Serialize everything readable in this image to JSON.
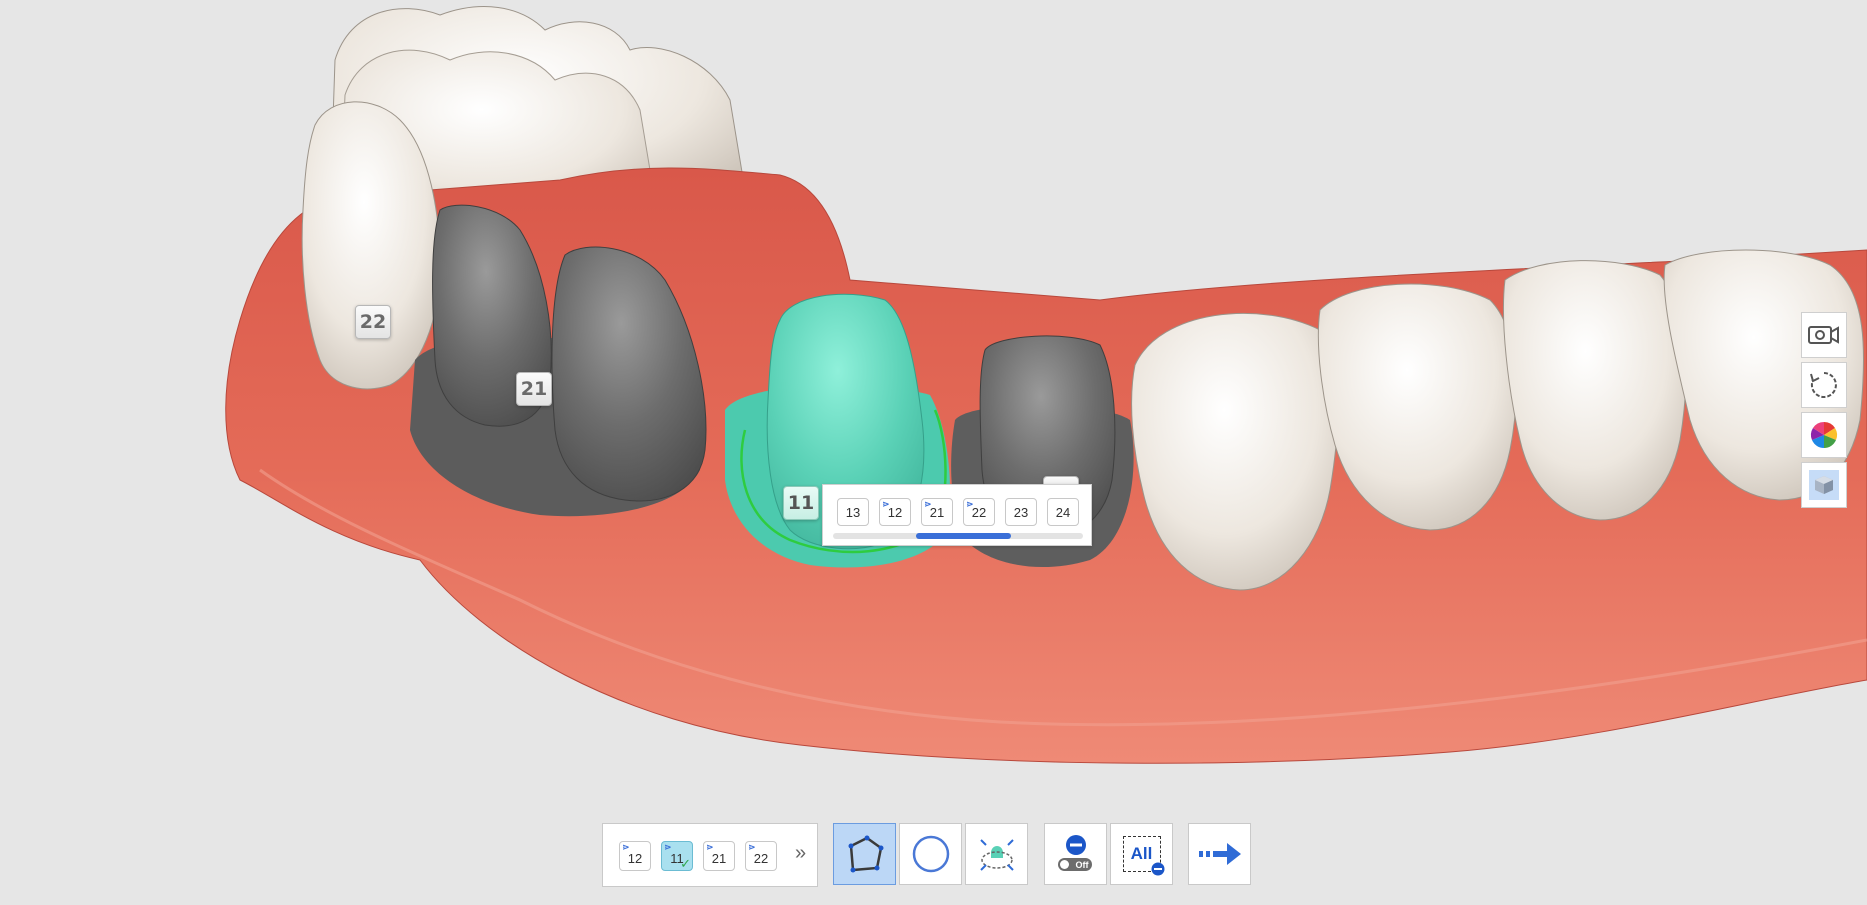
{
  "scene": {
    "colors": {
      "background": "#e6e6e6",
      "gum": "#e06654",
      "tooth": "#eee8e0",
      "prep": "#6b6b6b",
      "selected_prep": "#5ad1b6",
      "margin_line": "#2ecc40"
    },
    "tooth_labels": [
      {
        "id": "22",
        "label": "22"
      },
      {
        "id": "21",
        "label": "21"
      },
      {
        "id": "11",
        "label": "11",
        "active": true
      }
    ]
  },
  "tooth_selector": {
    "teeth": [
      {
        "label": "13",
        "prepared": false
      },
      {
        "label": "12",
        "prepared": true
      },
      {
        "label": "21",
        "prepared": true
      },
      {
        "label": "22",
        "prepared": true
      },
      {
        "label": "23",
        "prepared": false
      },
      {
        "label": "24",
        "prepared": false
      }
    ],
    "scroll": {
      "start": 0.33,
      "length": 0.38
    },
    "accent": "#3a6fd8"
  },
  "side_toolbar": [
    {
      "name": "camera-icon"
    },
    {
      "name": "rotate-icon"
    },
    {
      "name": "color-wheel-icon"
    },
    {
      "name": "cube-icon",
      "active": true
    }
  ],
  "bottom_toolbar": {
    "teeth": [
      {
        "label": "12",
        "active": false,
        "done": false
      },
      {
        "label": "11",
        "active": true,
        "done": true
      },
      {
        "label": "21",
        "active": false,
        "done": false
      },
      {
        "label": "22",
        "active": false,
        "done": false
      }
    ],
    "more_icon": "»",
    "tools": [
      {
        "name": "polygon-margin-icon",
        "active": true
      },
      {
        "name": "circle-icon",
        "active": false
      },
      {
        "name": "auto-margin-icon",
        "active": false
      }
    ],
    "off_toggle_label": "Off",
    "all_label": "All",
    "next_icon": "arrow-right-icon"
  }
}
